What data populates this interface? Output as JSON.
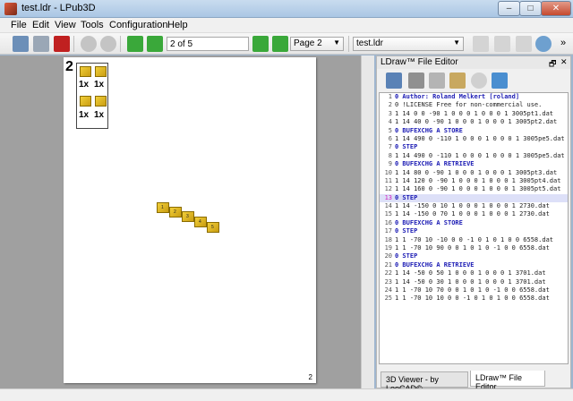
{
  "window": {
    "title": "test.ldr - LPub3D",
    "min": "–",
    "max": "□",
    "close": "✕"
  },
  "menu": [
    "File",
    "Edit",
    "View",
    "Tools",
    "Configuration",
    "Help"
  ],
  "toolbar": {
    "page_field": "2 of 5",
    "page_combo": "Page 2",
    "file_combo": "test.ldr",
    "overflow": "»"
  },
  "page": {
    "step_number": "2",
    "pli_quantities": [
      "1x",
      "1x",
      "1x",
      "1x"
    ],
    "part_labels": [
      "1",
      "2",
      "3",
      "4",
      "5"
    ],
    "page_number": "2"
  },
  "dock": {
    "title": "LDraw™ File Editor",
    "float_btn": "🗗",
    "close_btn": "✕",
    "tabs": [
      "3D Viewer - by LeoCAD©",
      "LDraw™ File Editor"
    ],
    "lines": [
      {
        "n": "1",
        "t": "0 Author: Roland Melkert [roland]",
        "kw": true
      },
      {
        "n": "2",
        "t": "0 !LICENSE Free for non-commercial use.",
        "kw": false
      },
      {
        "n": "3",
        "t": "1 14 0 0 -90 1 0 0 0 1 0 0 0 1 3005pt1.dat",
        "kw": false
      },
      {
        "n": "4",
        "t": "1 14 40 0 -90 1 0 0 0 1 0 0 0 1 3005pt2.dat",
        "kw": false
      },
      {
        "n": "5",
        "t": "0 BUFEXCHG A STORE",
        "kw": true
      },
      {
        "n": "6",
        "t": "1 14 490 0 -110 1 0 0 0 1 0 0 0 1 3005pe5.dat",
        "kw": false
      },
      {
        "n": "7",
        "t": "0 STEP",
        "kw": true
      },
      {
        "n": "8",
        "t": "1 14 490 0 -110 1 0 0 0 1 0 0 0 1 3005pe5.dat",
        "kw": false
      },
      {
        "n": "9",
        "t": "0 BUFEXCHG A RETRIEVE",
        "kw": true
      },
      {
        "n": "10",
        "t": "1 14 80 0 -90 1 0 0 0 1 0 0 0 1 3005pt3.dat",
        "kw": false
      },
      {
        "n": "11",
        "t": "1 14 120 0 -90 1 0 0 0 1 0 0 0 1 3005pt4.dat",
        "kw": false
      },
      {
        "n": "12",
        "t": "1 14 160 0 -90 1 0 0 0 1 0 0 0 1 3005pt5.dat",
        "kw": false
      },
      {
        "n": "13",
        "t": "0 STEP",
        "kw": true,
        "current": true
      },
      {
        "n": "14",
        "t": "1 14 -150 0 10 1 0 0 0 1 0 0 0 1 2730.dat",
        "kw": false
      },
      {
        "n": "15",
        "t": "1 14 -150 0 70 1 0 0 0 1 0 0 0 1 2730.dat",
        "kw": false
      },
      {
        "n": "16",
        "t": "0 BUFEXCHG A STORE",
        "kw": true
      },
      {
        "n": "17",
        "t": "0 STEP",
        "kw": true
      },
      {
        "n": "18",
        "t": "1 1 -70 10 -10 0 0 -1 0 1 0 1 0 0 6558.dat",
        "kw": false
      },
      {
        "n": "19",
        "t": "1 1 -70 10 90 0 0 1 0 1 0 -1 0 0 6558.dat",
        "kw": false
      },
      {
        "n": "20",
        "t": "0 STEP",
        "kw": true
      },
      {
        "n": "21",
        "t": "0 BUFEXCHG A RETRIEVE",
        "kw": true
      },
      {
        "n": "22",
        "t": "1 14 -50 0 50 1 0 0 0 1 0 0 0 1 3701.dat",
        "kw": false
      },
      {
        "n": "23",
        "t": "1 14 -50 0 30 1 0 0 0 1 0 0 0 1 3701.dat",
        "kw": false
      },
      {
        "n": "24",
        "t": "1 1 -70 10 70 0 0 1 0 1 0 -1 0 0 6558.dat",
        "kw": false
      },
      {
        "n": "25",
        "t": "1 1 -70 10 10 0 0 -1 0 1 0 1 0 0 6558.dat",
        "kw": false
      }
    ]
  },
  "colors": {
    "keyword": "#1b1bb4",
    "current_line": "#dde0f8",
    "brick": "#f2cf3a"
  }
}
